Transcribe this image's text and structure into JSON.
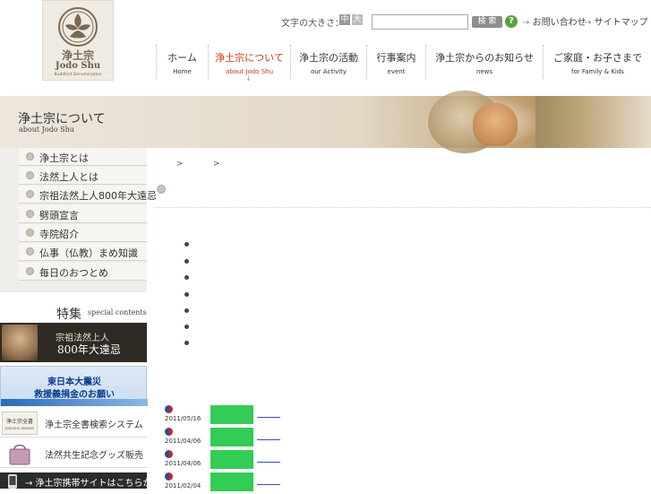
{
  "logo": {
    "title": "浄土宗",
    "subtitle_en": "Jodo Shu",
    "tagline": "Buddhist Denomination"
  },
  "header": {
    "font_size_label": "文字の大きさ：",
    "size_mid": "中",
    "size_big": "大",
    "search_value": "",
    "search_button": "検 索",
    "help_icon": "?",
    "contact_link": "お問い合わせ",
    "sitemap_link": "サイトマップ",
    "link_arrow": "→"
  },
  "nav": {
    "items": [
      {
        "jp": "ホーム",
        "en": "Home"
      },
      {
        "jp": "浄土宗について",
        "en": "about Jodo Shu",
        "active": true
      },
      {
        "jp": "浄土宗の活動",
        "en": "our Activity"
      },
      {
        "jp": "行事案内",
        "en": "event"
      },
      {
        "jp": "浄土宗からのお知らせ",
        "en": "news"
      },
      {
        "jp": "ご家庭・お子さまで",
        "en": "for Family & Kids"
      }
    ],
    "active_arrow": "↓"
  },
  "banner": {
    "title": "浄土宗について",
    "subtitle": "about Jodo Shu"
  },
  "sidebar": {
    "items": [
      {
        "label": "浄土宗とは"
      },
      {
        "label": "法然上人とは"
      },
      {
        "label": "宗祖法然上人800年大遠忌"
      },
      {
        "label": "劈頭宣言"
      },
      {
        "label": "寺院紹介"
      },
      {
        "label": "仏事（仏教）まめ知識"
      },
      {
        "label": "毎日のおつとめ"
      }
    ],
    "special_title": "特集",
    "special_sub": "special contents",
    "banner_800": {
      "line1": "宗祖法然上人",
      "line2": "800年大遠忌"
    },
    "quake": {
      "line1": "東日本大震災",
      "line2": "救援義捐金のお願い"
    },
    "zensho": {
      "thumb_text": "浄土宗全書",
      "thumb_sub": "JODOSHU ZENSHO",
      "label": "浄土宗全書検索システム"
    },
    "goods": {
      "label": "法然共生記念グッズ販売"
    },
    "mobile": {
      "label": "→ 浄土宗携帯サイトはこちらから"
    }
  },
  "breadcrumb": {
    "sep1": ">",
    "sep2": ">"
  },
  "news": [
    {
      "date": "2011/05/16"
    },
    {
      "date": "2011/04/06"
    },
    {
      "date": "2011/04/06"
    },
    {
      "date": "2011/02/04"
    }
  ],
  "colors": {
    "accent_red": "#c33b18",
    "news_tag_green": "#33cc55",
    "link_blue": "#3c4fb4",
    "quake_text_blue": "#0a3c8f"
  }
}
